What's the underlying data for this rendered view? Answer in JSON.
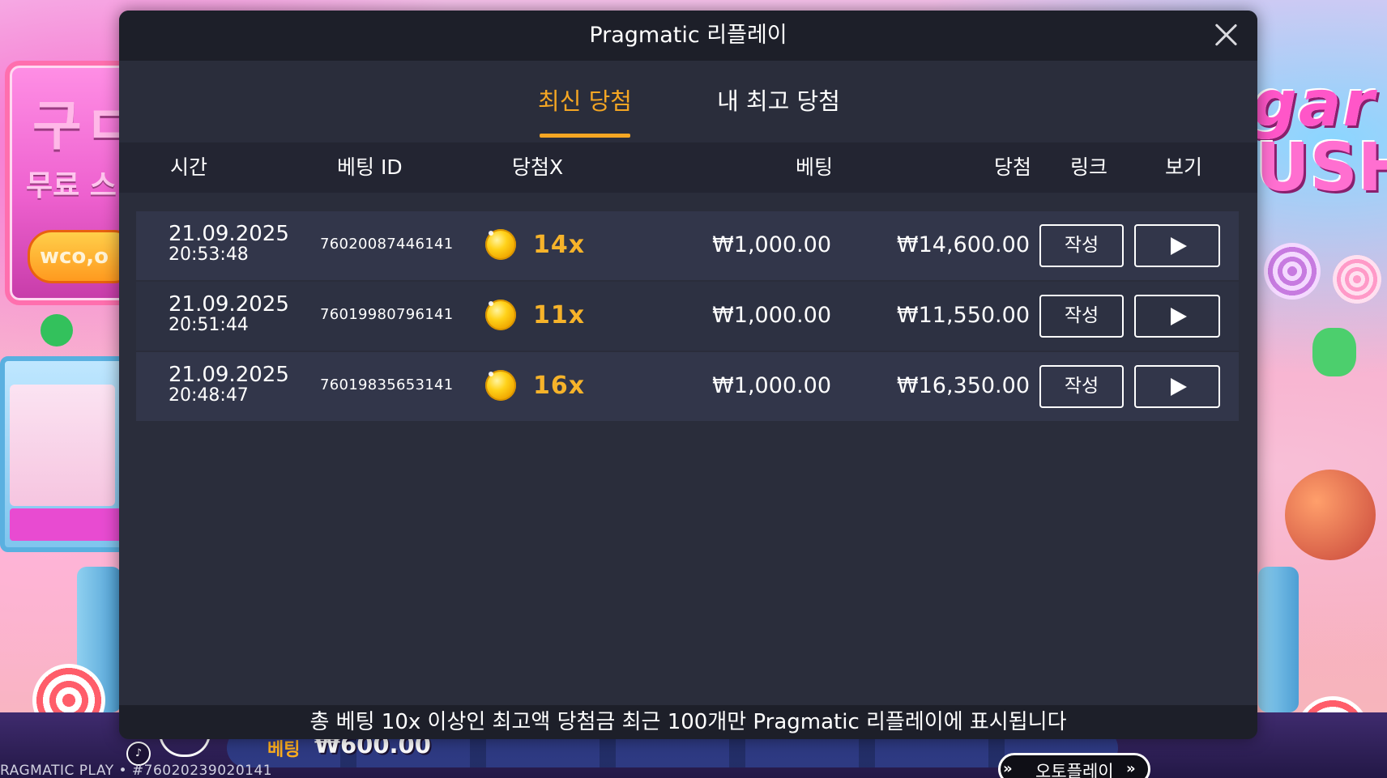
{
  "modal": {
    "title": "Pragmatic 리플레이",
    "tabs": [
      {
        "label": "최신 당첨",
        "active": true
      },
      {
        "label": "내 최고 당첨",
        "active": false
      }
    ],
    "columns": {
      "time": "시간",
      "bet_id": "베팅 ID",
      "multiplier": "당첨X",
      "bet": "베팅",
      "win": "당첨",
      "link": "링크",
      "view": "보기"
    },
    "rows": [
      {
        "date": "21.09.2025",
        "time": "20:53:48",
        "bet_id": "76020087446141",
        "multiplier": "14x",
        "bet": "₩1,000.00",
        "win": "₩14,600.00",
        "write_label": "작성"
      },
      {
        "date": "21.09.2025",
        "time": "20:51:44",
        "bet_id": "76019980796141",
        "multiplier": "11x",
        "bet": "₩1,000.00",
        "win": "₩11,550.00",
        "write_label": "작성"
      },
      {
        "date": "21.09.2025",
        "time": "20:48:47",
        "bet_id": "76019835653141",
        "multiplier": "16x",
        "bet": "₩1,000.00",
        "win": "₩16,350.00",
        "write_label": "작성"
      }
    ],
    "footer_note": "총 베팅 10x 이상인 최고액 당첨금 최근 100개만 Pragmatic 리플레이에 표시됩니다"
  },
  "game_background": {
    "left_title": "구ㅁ",
    "left_subtitle": "무료 스",
    "left_pill": "wco,o",
    "right_logo_line1": "gar",
    "right_logo_line2": "USH",
    "bet_label": "베팅",
    "bet_value": "₩600.00",
    "provider_line": "RAGMATIC PLAY • #76020239020141",
    "autoplay_label": "오토플레이"
  },
  "icons": {
    "close": "close-icon",
    "coin": "coin-icon",
    "play": "play-icon",
    "sound": "speaker-icon"
  },
  "colors": {
    "modal_bg": "#2a2d3b",
    "header_bg": "#1d1f29",
    "accent": "#f5a623",
    "multiplier": "#f6b32a"
  }
}
